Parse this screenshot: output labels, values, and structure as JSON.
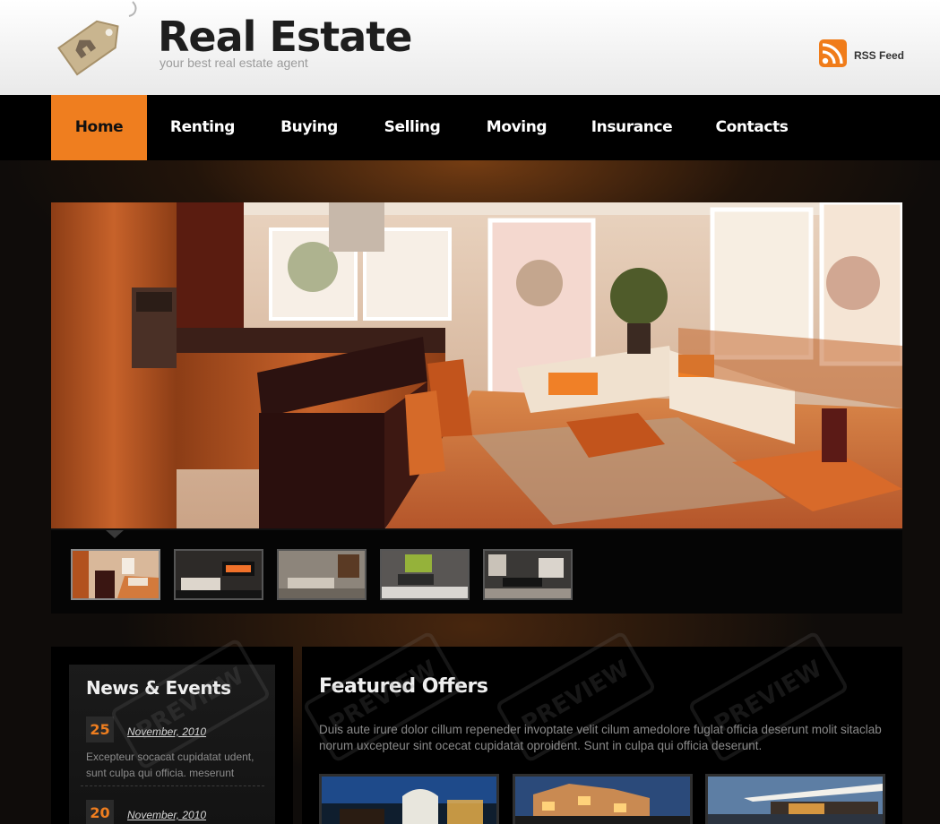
{
  "header": {
    "title": "Real Estate",
    "tagline": "your best real estate agent",
    "rss_label": "RSS Feed"
  },
  "nav": {
    "items": [
      {
        "label": "Home",
        "active": true
      },
      {
        "label": "Renting"
      },
      {
        "label": "Buying"
      },
      {
        "label": "Selling"
      },
      {
        "label": "Moving"
      },
      {
        "label": "Insurance"
      },
      {
        "label": "Contacts"
      }
    ]
  },
  "slider": {
    "thumb_count": 5,
    "active_thumb": 1
  },
  "news": {
    "title": "News & Events",
    "items": [
      {
        "day": "25",
        "date": "November, 2010",
        "text": "Excepteur socacat cupidatat udent, sunt culpa qui officia. meserunt"
      },
      {
        "day": "20",
        "date": "November, 2010",
        "text": ""
      }
    ]
  },
  "featured": {
    "title": "Featured Offers",
    "text": "Duis aute irure dolor cillum repeneder invoptate velit cilum amedolore fuglat officia deserunt molit sitaclab norum uxcepteur sint ocecat cupidatat oproident. Sunt in culpa qui officia deserunt."
  },
  "watermark": {
    "text": "PREVIEW"
  },
  "colors": {
    "accent": "#ef7e1f",
    "nav_bg": "#000000",
    "header_bg": "#f4f4f4"
  }
}
